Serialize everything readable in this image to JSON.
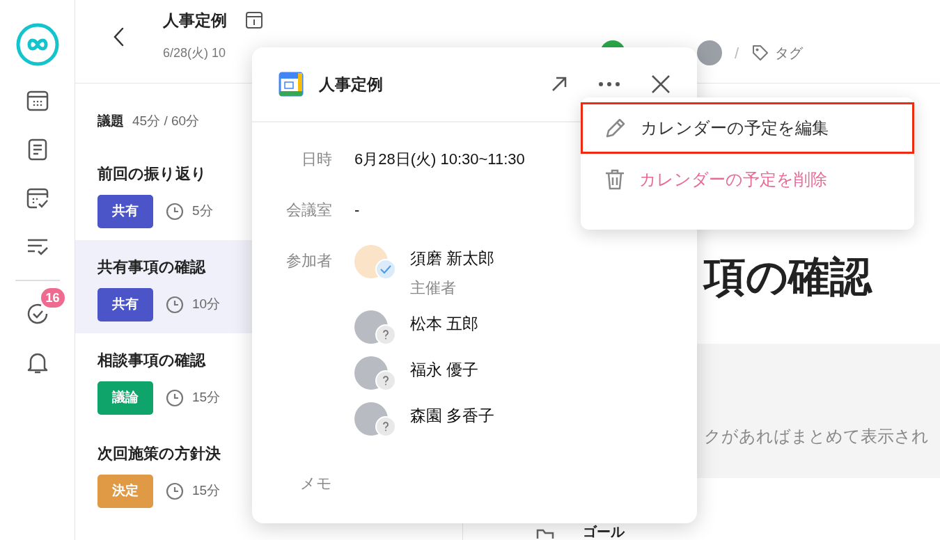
{
  "sidebar": {
    "items": [
      {
        "kind": "calendar"
      },
      {
        "kind": "document"
      },
      {
        "kind": "schedule"
      },
      {
        "kind": "checklist"
      },
      {
        "kind": "divider"
      },
      {
        "kind": "task",
        "badge": "16"
      },
      {
        "kind": "bell"
      }
    ]
  },
  "header": {
    "title": "人事定例",
    "date": "6/28(火) 10",
    "separator": "/",
    "tag_label": "タグ"
  },
  "agenda": {
    "title": "議題",
    "time_summary": "45分 / 60分",
    "items": [
      {
        "title": "前回の振り返り",
        "tag": "共有",
        "color": "#4b55c8",
        "duration": "5分",
        "selected": false
      },
      {
        "title": "共有事項の確認",
        "tag": "共有",
        "color": "#4b55c8",
        "duration": "10分",
        "selected": true
      },
      {
        "title": "相談事項の確認",
        "tag": "議論",
        "color": "#0ea46a",
        "duration": "15分",
        "selected": false
      },
      {
        "title": "次回施策の方針決",
        "tag": "決定",
        "color": "#e09a45",
        "duration": "15分",
        "selected": false
      }
    ]
  },
  "main": {
    "heading": "項の確認",
    "note": "クがあればまとめて表示され",
    "section": "ゴール"
  },
  "event_popup": {
    "title": "人事定例",
    "fields": [
      {
        "label": "日時",
        "value": "6月28日(火) 10:30~11:30"
      },
      {
        "label": "会議室",
        "value": "-"
      }
    ],
    "attendees_label": "参加者",
    "attendees": [
      {
        "name": "須磨 新太郎",
        "role": "主催者",
        "accepted": true,
        "kind": "illustration"
      },
      {
        "name": "松本 五郎",
        "accepted": false,
        "kind": "photo"
      },
      {
        "name": "福永 優子",
        "accepted": false,
        "kind": "photo"
      },
      {
        "name": "森園 多香子",
        "accepted": false,
        "kind": "photo"
      }
    ],
    "memo_label": "メモ"
  },
  "menu": {
    "items": [
      {
        "kind": "edit",
        "label": "カレンダーの予定を編集",
        "highlighted": true
      },
      {
        "kind": "delete",
        "label": "カレンダーの予定を削除",
        "highlighted": false
      }
    ]
  }
}
